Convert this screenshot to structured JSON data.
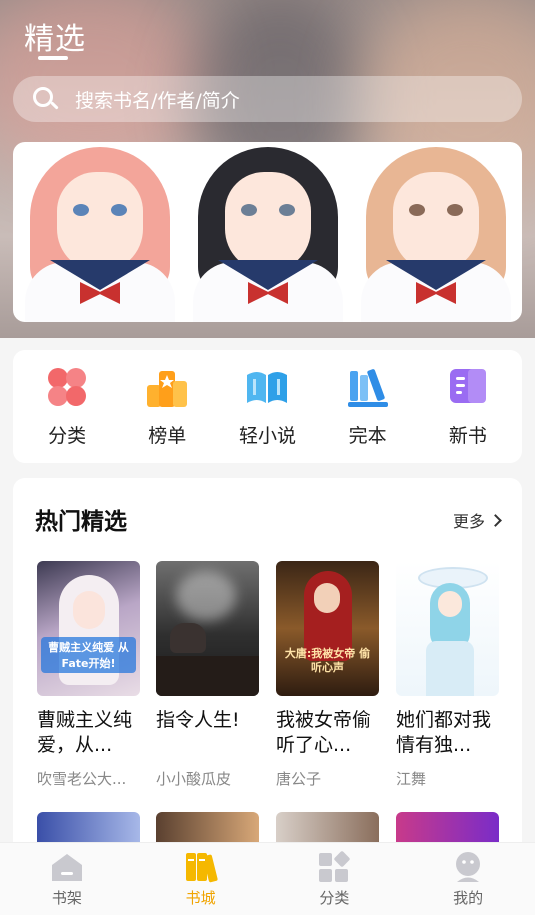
{
  "header": {
    "title": "精选"
  },
  "search": {
    "placeholder": "搜索书名/作者/简介"
  },
  "categories": [
    {
      "label": "分类",
      "icon": "grid-clover-icon"
    },
    {
      "label": "榜单",
      "icon": "ranking-podium-icon"
    },
    {
      "label": "轻小说",
      "icon": "open-book-icon"
    },
    {
      "label": "完本",
      "icon": "books-stack-icon"
    },
    {
      "label": "新书",
      "icon": "new-book-icon"
    }
  ],
  "hot": {
    "title": "热门精选",
    "more": "更多",
    "books": [
      {
        "title": "曹贼主义纯爱，从...",
        "author": "吹雪老公大...",
        "cover_text": "曹贼主义纯爱 从Fate开始!"
      },
      {
        "title": "指令人生!",
        "author": "小小酸瓜皮",
        "cover_text": ""
      },
      {
        "title": "我被女帝偷听了心...",
        "author": "唐公子",
        "cover_text": "大唐:我被女帝 偷听心声"
      },
      {
        "title": "她们都对我情有独...",
        "author": "江舞",
        "cover_text": ""
      }
    ]
  },
  "tabbar": {
    "tabs": [
      {
        "label": "书架",
        "icon": "bookshelf-icon",
        "active": false
      },
      {
        "label": "书城",
        "icon": "bookstore-icon",
        "active": true
      },
      {
        "label": "分类",
        "icon": "category-icon",
        "active": false
      },
      {
        "label": "我的",
        "icon": "profile-icon",
        "active": false
      }
    ]
  },
  "colors": {
    "accent": "#f0a400",
    "background": "#f5f5f5",
    "card": "#ffffff"
  }
}
